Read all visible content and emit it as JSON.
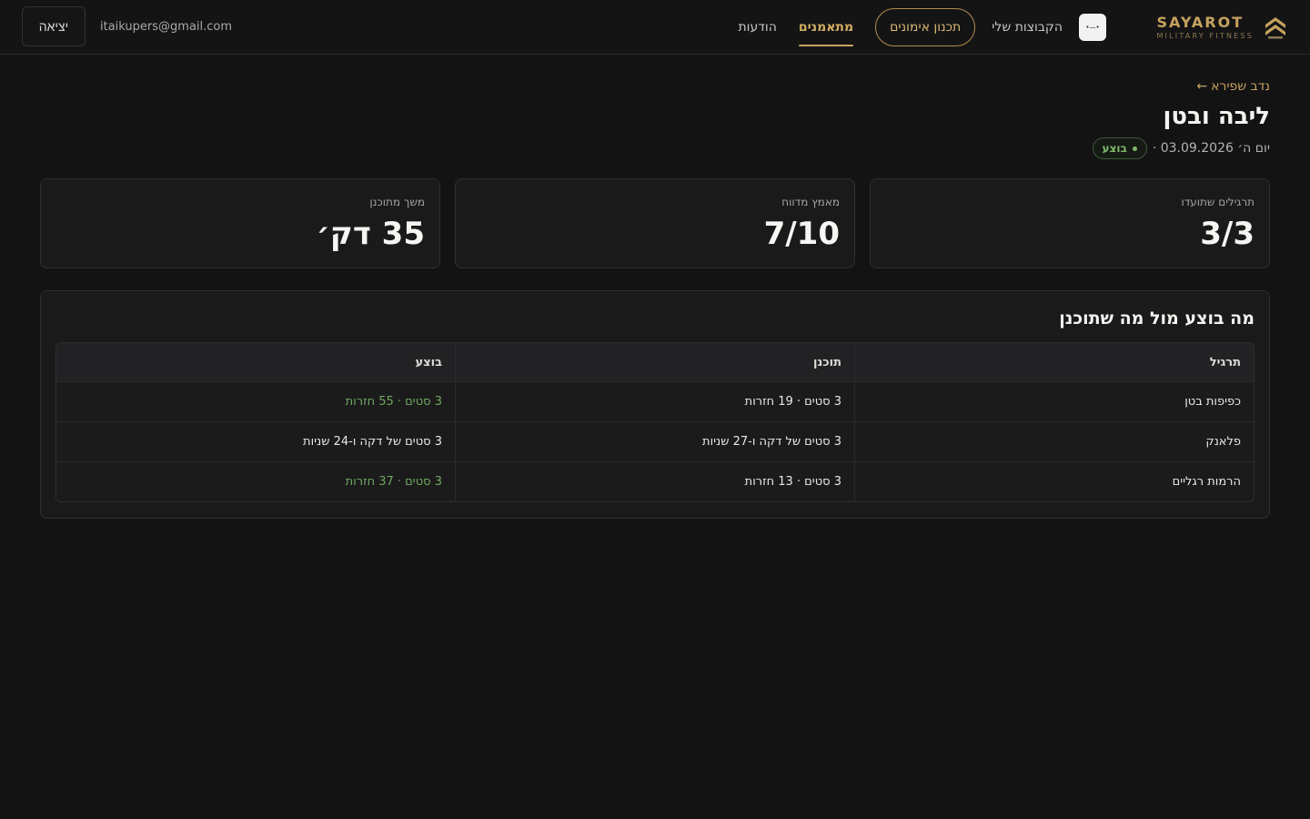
{
  "brand": {
    "name": "SAYAROT",
    "subtitle": "MILITARY FITNESS"
  },
  "nav": {
    "app_chip_text": "•—•",
    "groups": "הקבוצות שלי",
    "training_plan": "תכנון אימונים",
    "trainees": "מתאמנים",
    "messages": "הודעות"
  },
  "user": {
    "email": "itaikupers@gmail.com",
    "logout": "יציאה"
  },
  "page": {
    "back_arrow": "←",
    "back_label": "נדב שפירא",
    "title": "ליבה ובטן",
    "date": "יום ה׳ 03.09.2026 ·",
    "status": "בוצע"
  },
  "stats": [
    {
      "label": "תרגילים שתועדו",
      "value": "3/3"
    },
    {
      "label": "מאמץ מדווח",
      "value": "7/10"
    },
    {
      "label": "משך מתוכנן",
      "value": "35 דק׳"
    }
  ],
  "comparison": {
    "title": "מה בוצע מול מה שתוכנן",
    "columns": [
      "תרגיל",
      "תוכנן",
      "בוצע"
    ],
    "rows": [
      {
        "exercise": "כפיפות בטן",
        "planned": "3 סטים · 19 חזרות",
        "done": "3 סטים · 55 חזרות",
        "done_highlight": true
      },
      {
        "exercise": "פלאנק",
        "planned": "3 סטים של דקה ו-27 שניות",
        "done": "3 סטים של דקה ו-24 שניות",
        "done_highlight": false
      },
      {
        "exercise": "הרמות רגליים",
        "planned": "3 סטים · 13 חזרות",
        "done": "3 סטים · 37 חזרות",
        "done_highlight": true
      }
    ]
  },
  "colors": {
    "accent": "#c6a25e",
    "success": "#6fa85d",
    "background": "#131314"
  }
}
